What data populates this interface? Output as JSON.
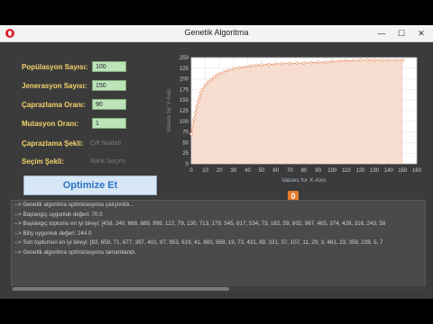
{
  "window": {
    "title": "Genetik Algoritma",
    "minimize": "—",
    "maximize": "☐",
    "close": "✕"
  },
  "form": {
    "pop_label": "Popülasyon Sayısı:",
    "pop_value": "100",
    "gen_label": "Jenerasyon Sayısı:",
    "gen_value": "150",
    "cross_label": "Çaprazlama Oranı:",
    "cross_value": "90",
    "mut_label": "Mutasyon Oranı:",
    "mut_value": "1",
    "cross_type_label": "Çaprazlama Şekli:",
    "cross_type_value": "Çift Noktalı",
    "sel_label": "Seçim Şekli:",
    "sel_value": "Rank Seçimi",
    "optimize_button": "Optimize Et"
  },
  "badge": "0",
  "log_lines": [
    "--> Genetik algoritma optimizasyonu çalıştırıldı...",
    "--> Başlangıç uygunluk değeri: 70.0",
    "--> Başlangıç toplumu en iyi bireyi: [458, 240, 668, 689, 998, 122, 79, 130, 713, 179, 545, 817, 534, 73, 162, 59, 802, 967, 465, 374, 428, 316, 243, 58",
    "--> Bitiş uygunluk değeri: 244.0",
    "--> Son toplumun en iyi bireyi: [83, 659, 71, 677, 397, 401, 97, 953, 619, 41, 883, 569, 19, 73, 431, 89, 331, 37, 107, 11, 29, 3, 461, 23, 359, 239, 5, 7",
    "--> Genetik algoritma optimizasyonu tamamlandı."
  ],
  "chart_data": {
    "type": "area",
    "xlabel": "Values for X-Axis",
    "ylabel": "Values for Y-Axis",
    "xlim": [
      0,
      160
    ],
    "ylim": [
      0,
      250
    ],
    "xticks": [
      0,
      10,
      20,
      30,
      40,
      50,
      60,
      70,
      80,
      90,
      100,
      110,
      120,
      130,
      140,
      150,
      160
    ],
    "yticks": [
      0,
      25,
      50,
      75,
      100,
      125,
      150,
      175,
      200,
      225,
      250
    ],
    "grid": true,
    "colors": {
      "line": "#e8956a",
      "fill": "#f6d8c8"
    },
    "series": [
      {
        "x": [
          0,
          1,
          2,
          3,
          4,
          5,
          6,
          7,
          8,
          10,
          12,
          14,
          16,
          18,
          20,
          23,
          26,
          30,
          34,
          38,
          42,
          46,
          50,
          55,
          60,
          65,
          70,
          75,
          80,
          85,
          90,
          95,
          100,
          105,
          110,
          115,
          120,
          125,
          130,
          135,
          140,
          145,
          150
        ],
        "values": [
          70,
          90,
          105,
          120,
          135,
          148,
          158,
          168,
          175,
          185,
          192,
          198,
          203,
          208,
          212,
          216,
          220,
          224,
          226,
          228,
          230,
          232,
          233,
          234,
          235,
          236,
          236,
          237,
          237,
          238,
          239,
          239,
          241,
          242,
          243,
          243,
          244,
          244,
          244,
          244,
          244,
          244,
          244
        ]
      }
    ]
  }
}
